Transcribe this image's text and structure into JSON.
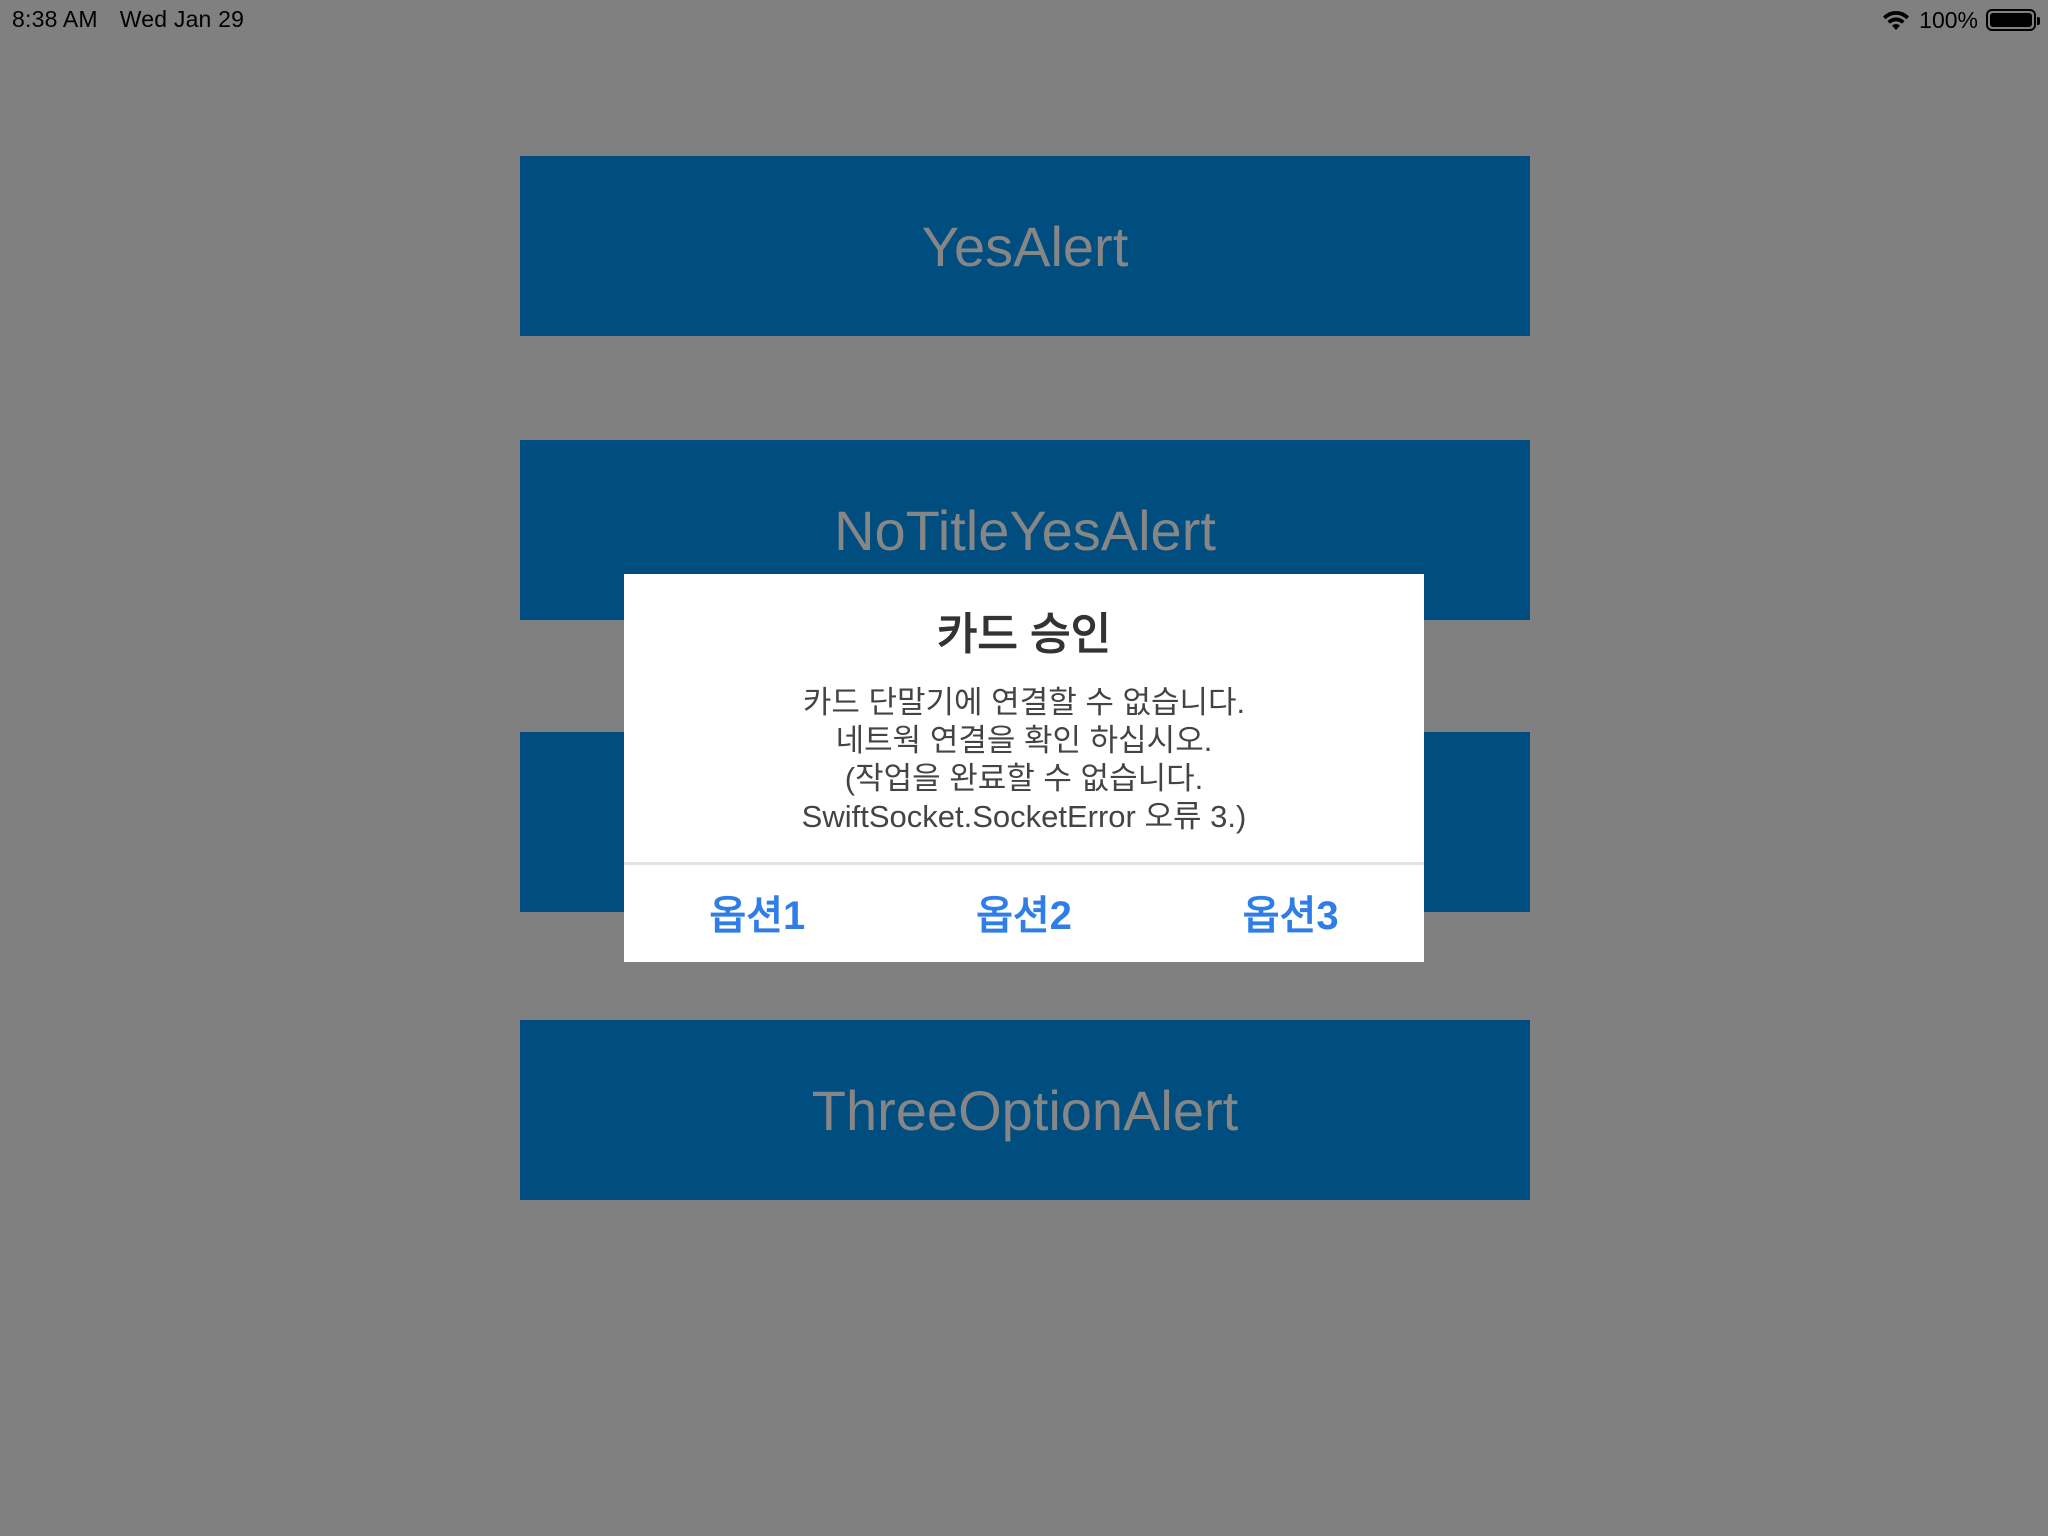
{
  "status_bar": {
    "time": "8:38 AM",
    "date": "Wed Jan 29",
    "battery_percent": "100%",
    "battery_level": 1.0
  },
  "buttons": [
    {
      "label": "YesAlert"
    },
    {
      "label": "NoTitleYesAlert"
    },
    {
      "label": ""
    },
    {
      "label": "ThreeOptionAlert"
    }
  ],
  "alert": {
    "title": "카드 승인",
    "message_lines": [
      "카드 단말기에 연결할 수 없습니다.",
      "네트웍 연결을 확인 하십시오.",
      "(작업을 완료할 수 없습니다.",
      "SwiftSocket.SocketError 오류 3.)"
    ],
    "actions": [
      "옵션1",
      "옵션2",
      "옵션3"
    ]
  },
  "colors": {
    "background": "#808080",
    "button_bg": "#004d80",
    "button_text": "#868686",
    "alert_action": "#2f7ee8"
  }
}
